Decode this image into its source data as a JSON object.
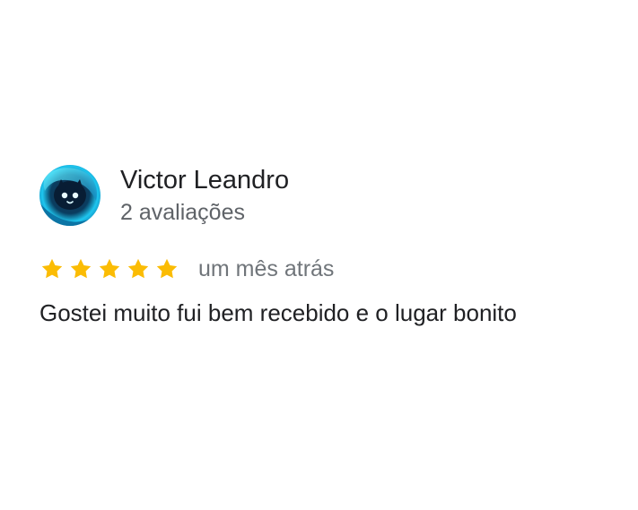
{
  "review": {
    "author_name": "Victor Leandro",
    "review_count": "2 avaliações",
    "rating": 5,
    "rating_max": 5,
    "date": "um mês atrás",
    "text": "Gostei muito fui bem recebido e o lugar bonito"
  },
  "colors": {
    "star": "#fbbc04",
    "avatar_bg": "#0b2a44",
    "avatar_glow": "#38d7ff",
    "primary_text": "#202124",
    "secondary_text": "#5f6368"
  },
  "icons": {
    "avatar": "profile-avatar-icon",
    "star": "star-filled-icon"
  }
}
